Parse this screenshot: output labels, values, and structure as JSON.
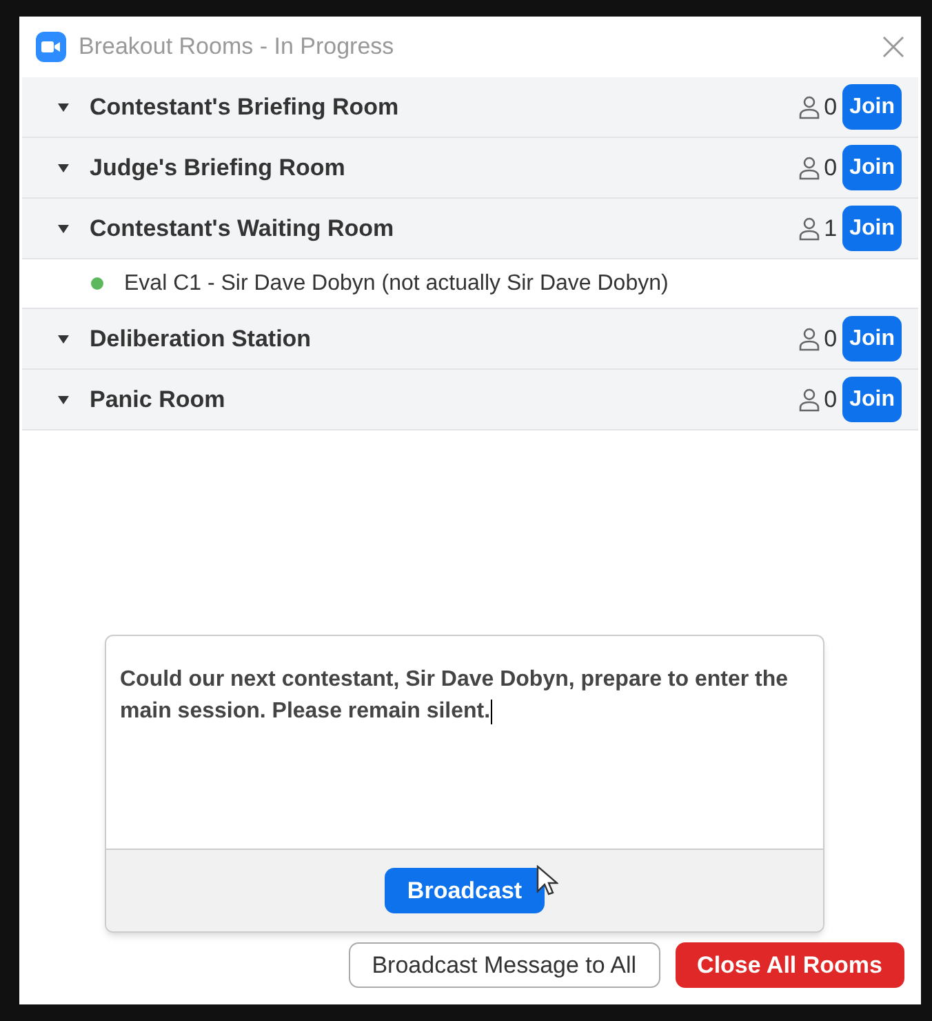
{
  "window": {
    "title": "Breakout Rooms - In Progress"
  },
  "rooms": [
    {
      "name": "Contestant's Briefing Room",
      "count": "0",
      "join": "Join",
      "expanded": true
    },
    {
      "name": "Judge's Briefing Room",
      "count": "0",
      "join": "Join",
      "expanded": true
    },
    {
      "name": "Contestant's Waiting Room",
      "count": "1",
      "join": "Join",
      "expanded": true,
      "participants": [
        {
          "name": "Eval C1 - Sir Dave Dobyn (not actually Sir Dave Dobyn)",
          "color": "#5cb85c"
        }
      ]
    },
    {
      "name": "Deliberation Station",
      "count": "0",
      "join": "Join",
      "expanded": true
    },
    {
      "name": "Panic Room",
      "count": "0",
      "join": "Join",
      "expanded": true
    }
  ],
  "broadcast_popup": {
    "message": "Could our next contestant, Sir Dave Dobyn, prepare to enter the main session. Please remain silent.",
    "button": "Broadcast"
  },
  "footer": {
    "broadcast_button": "Broadcast Message to All",
    "close_button": "Close All Rooms"
  }
}
